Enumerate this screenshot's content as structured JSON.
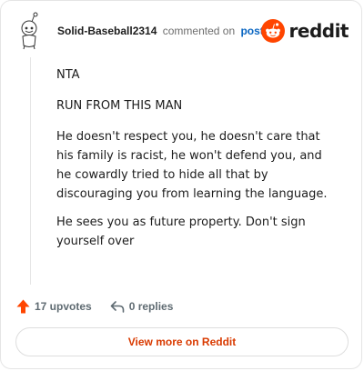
{
  "header": {
    "username": "Solid-Baseball2314",
    "action_text": "commented on",
    "post_link": "post",
    "brand_name": "reddit",
    "brand_color": "#ff4500"
  },
  "comment": {
    "paragraphs": [
      "NTA",
      "RUN FROM THIS MAN",
      "He doesn't respect you, he doesn't care that his family is racist, he won't defend you, and he cowardly tried to hide all that by discouraging you from learning the language.",
      "He sees you as future property. Don't sign yourself over"
    ]
  },
  "actions": {
    "upvotes": "17 upvotes",
    "upvote_icon": "upvote-arrow-icon",
    "replies": "0 replies",
    "reply_icon": "reply-arrow-icon"
  },
  "footer": {
    "view_more_label": "View more on Reddit",
    "accent_color": "#d93a00"
  }
}
